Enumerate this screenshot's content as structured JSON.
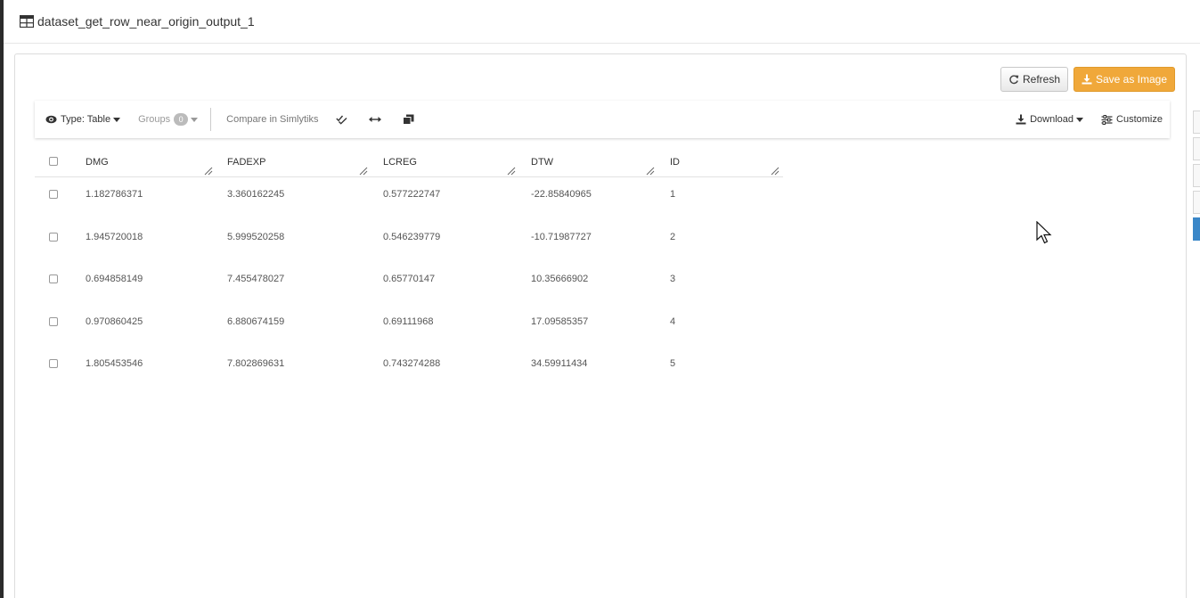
{
  "window": {
    "title": "dataset_get_row_near_origin_output_1"
  },
  "actions": {
    "refresh_label": "Refresh",
    "save_image_label": "Save as Image"
  },
  "toolbar": {
    "type_label": "Type: Table",
    "groups_label": "Groups",
    "groups_count": "0",
    "compare_label": "Compare in Simlytiks",
    "download_label": "Download",
    "customize_label": "Customize"
  },
  "table": {
    "columns": [
      "DMG",
      "FADEXP",
      "LCREG",
      "DTW",
      "ID"
    ],
    "rows": [
      [
        "1.182786371",
        "3.360162245",
        "0.577222747",
        "-22.85840965",
        "1"
      ],
      [
        "1.945720018",
        "5.999520258",
        "0.546239779",
        "-10.71987727",
        "2"
      ],
      [
        "0.694858149",
        "7.455478027",
        "0.65770147",
        "10.35666902",
        "3"
      ],
      [
        "0.970860425",
        "6.880674159",
        "0.69111968",
        "17.09585357",
        "4"
      ],
      [
        "1.805453546",
        "7.802869631",
        "0.743274288",
        "34.59911434",
        "5"
      ]
    ]
  },
  "colors": {
    "save_button": "#f0a83a",
    "active_side_tab": "#3a87c8"
  },
  "icons": [
    "table-icon",
    "refresh-icon",
    "download-icon",
    "eye-icon",
    "check-all-icon",
    "expand-horizontal-icon",
    "copy-icon",
    "sliders-icon",
    "resize-handle-icon",
    "mouse-cursor-icon"
  ]
}
